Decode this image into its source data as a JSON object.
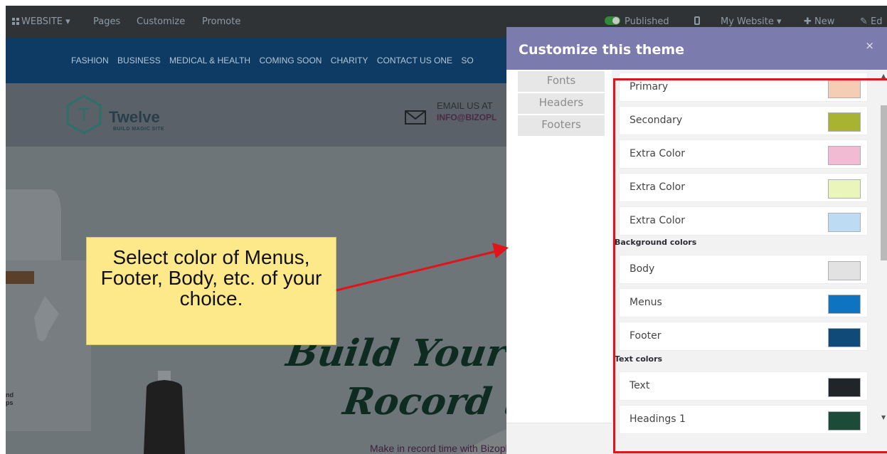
{
  "topbar": {
    "website_menu": "WEBSITE",
    "items": [
      "Pages",
      "Customize",
      "Promote"
    ],
    "published": "Published",
    "my_website": "My Website",
    "new": "New",
    "edit": "Ed"
  },
  "site": {
    "nav": [
      "FASHION",
      "BUSINESS",
      "MEDICAL & HEALTH",
      "COMING SOON",
      "CHARITY",
      "CONTACT US ONE",
      "SO"
    ],
    "logo_name": "Twelve",
    "logo_tag": "BUILD MAGIC SITE",
    "email_label": "EMAIL US AT",
    "email_value": "INFO@BIZOPL",
    "hero_line1": "Build Your S",
    "hero_line2": "Rocord ti",
    "hero_sub": "Make in record time with Bizople",
    "side_text_1": "nd",
    "side_text_2": "ps"
  },
  "callout": {
    "text": "Select color of Menus, Footer, Body, etc. of your choice."
  },
  "modal": {
    "title": "Customize this theme",
    "close": "×",
    "tabs": [
      "Fonts",
      "Headers",
      "Footers"
    ],
    "groups": {
      "background": "Background colors",
      "text": "Text colors"
    },
    "colors": [
      {
        "label": "Primary",
        "hex": "#f5cdb5"
      },
      {
        "label": "Secondary",
        "hex": "#a8b331"
      },
      {
        "label": "Extra Color",
        "hex": "#f1bcd3"
      },
      {
        "label": "Extra Color",
        "hex": "#e9f5bb"
      },
      {
        "label": "Extra Color",
        "hex": "#bddcf4"
      },
      {
        "label": "Body",
        "hex": "#e2e2e2"
      },
      {
        "label": "Menus",
        "hex": "#0e73c0"
      },
      {
        "label": "Footer",
        "hex": "#0f4a78"
      },
      {
        "label": "Text",
        "hex": "#212529"
      },
      {
        "label": "Headings 1",
        "hex": "#1d4b3a"
      }
    ]
  },
  "accent": {
    "highlight": "#e0141a",
    "callout_bg": "#fde98a"
  }
}
